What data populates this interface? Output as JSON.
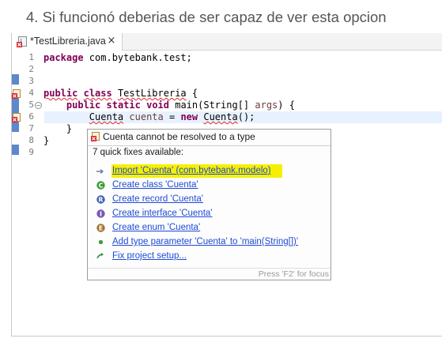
{
  "heading": "4. Si funcionó deberias de ser capaz de ver esta opcion",
  "tab": {
    "label": "*TestLibreria.java",
    "close_glyph": "×"
  },
  "gutter": {
    "line_numbers": [
      "1",
      "2",
      "3",
      "4",
      "5",
      "6",
      "7",
      "8",
      "9"
    ]
  },
  "code": {
    "line1": {
      "keyword": "package",
      "rest": " com.bytebank.test;"
    },
    "line4": {
      "kw1": "public",
      "kw2": "class",
      "class_name": "TestLibreria",
      "rest": " {"
    },
    "line5": {
      "kw1": "public",
      "kw2": "static",
      "kw3": "void",
      "rest": " main(String[] ",
      "param": "args",
      "tail": ") {"
    },
    "line6": {
      "type": "Cuenta",
      "var": "cuenta",
      "eq": " = ",
      "kw_new": "new",
      "ctor": "Cuenta",
      "tail": "();"
    },
    "line7": "}",
    "line8": "}"
  },
  "quickfix": {
    "error_message": "Cuenta cannot be resolved to a type",
    "count_label": "7 quick fixes available:",
    "items": [
      {
        "label": "Import 'Cuenta' (com.bytebank.modelo)",
        "icon": "import-icon"
      },
      {
        "label": "Create class 'Cuenta'",
        "icon": "class-icon"
      },
      {
        "label": "Create record 'Cuenta'",
        "icon": "record-icon"
      },
      {
        "label": "Create interface 'Cuenta'",
        "icon": "interface-icon"
      },
      {
        "label": "Create enum 'Cuenta'",
        "icon": "enum-icon"
      },
      {
        "label": "Add type parameter 'Cuenta' to 'main(String[])'",
        "icon": "type-parameter-icon"
      },
      {
        "label": "Fix project setup...",
        "icon": "fix-setup-icon"
      }
    ],
    "focus_hint": "Press 'F2' for focus",
    "icon_letters": {
      "class": "C",
      "record": "R",
      "interface": "I",
      "enum": "E"
    }
  },
  "colors": {
    "highlight": "#f6f000",
    "link": "#1f4bd4",
    "keyword": "#7f0055",
    "error": "#e0262c",
    "current_line": "#e8f2fe"
  }
}
